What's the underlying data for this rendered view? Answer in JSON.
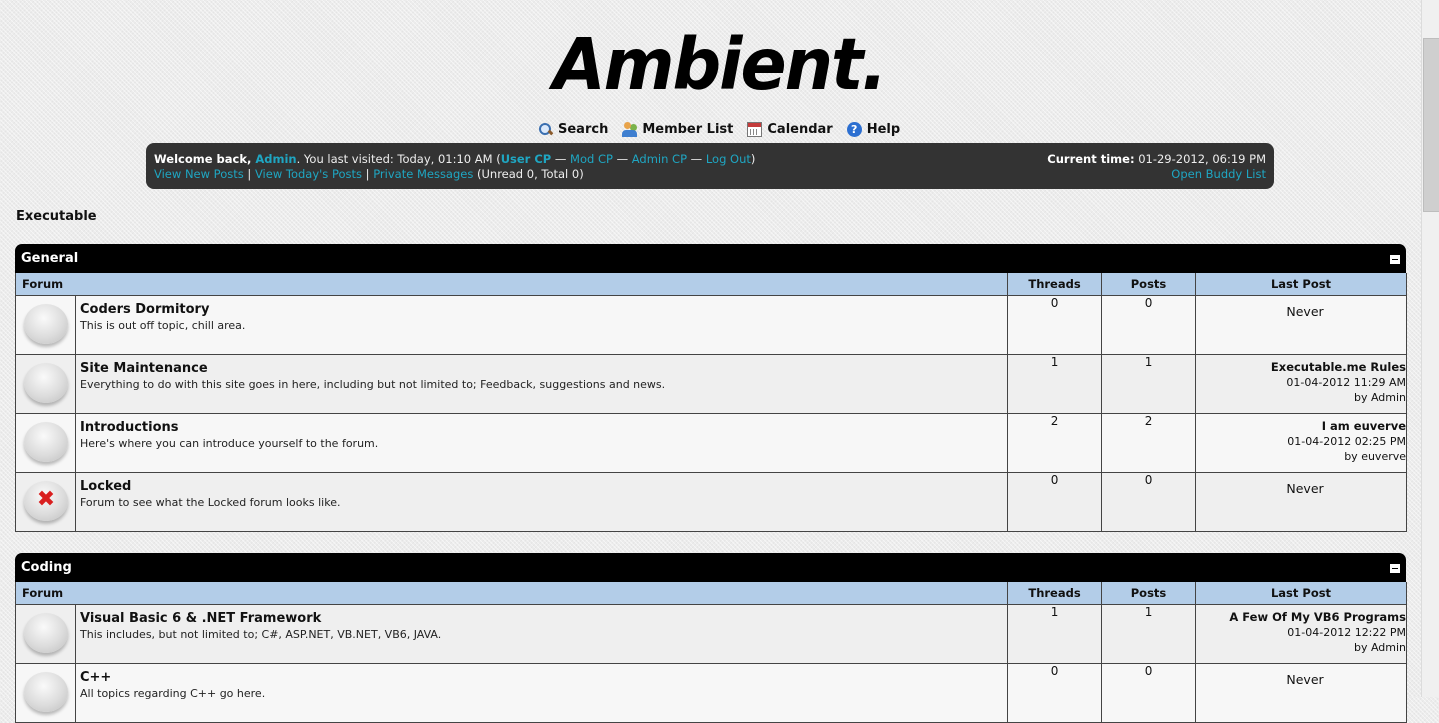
{
  "logo_text": "Ambient.",
  "nav": [
    {
      "label": "Search",
      "icon": "search-icon"
    },
    {
      "label": "Member List",
      "icon": "members-icon"
    },
    {
      "label": "Calendar",
      "icon": "calendar-icon"
    },
    {
      "label": "Help",
      "icon": "help-icon"
    }
  ],
  "welcome": {
    "prefix": "Welcome back, ",
    "user": "Admin",
    "visited": ". You last visited: Today, 01:10 AM (",
    "user_cp": "User CP",
    "sep": " — ",
    "mod_cp": "Mod CP",
    "admin_cp": "Admin CP",
    "logout": "Log Out",
    "close": ")",
    "view_new": "View New Posts",
    "pipe": " | ",
    "view_today": "View Today's Posts",
    "pm": "Private Messages",
    "pm_counts": " (Unread 0, Total 0)",
    "current_label": "Current time:",
    "current_value": " 01-29-2012, 06:19 PM",
    "buddy": "Open Buddy List"
  },
  "board_title": "Executable",
  "columns": {
    "forum": "Forum",
    "threads": "Threads",
    "posts": "Posts",
    "last": "Last Post"
  },
  "categories": [
    {
      "name": "General",
      "forums": [
        {
          "name": "Coders Dormitory",
          "desc": "This is out off topic, chill area.",
          "threads": "0",
          "posts": "0",
          "last": "Never"
        },
        {
          "name": "Site Maintenance",
          "desc": "Everything to do with this site goes in here, including but not limited to; Feedback, suggestions and news.",
          "threads": "1",
          "posts": "1",
          "last_title": "Executable.me Rules",
          "last_date": "01-04-2012 11:29 AM",
          "last_by": "by Admin"
        },
        {
          "name": "Introductions",
          "desc": "Here's where you can introduce yourself to the forum.",
          "threads": "2",
          "posts": "2",
          "last_title": "I am euverve",
          "last_date": "01-04-2012 02:25 PM",
          "last_by": "by euverve"
        },
        {
          "name": "Locked",
          "desc": "Forum to see what the Locked forum looks like.",
          "threads": "0",
          "posts": "0",
          "last": "Never",
          "locked": true
        }
      ]
    },
    {
      "name": "Coding",
      "forums": [
        {
          "name": "Visual Basic 6 & .NET Framework",
          "desc": "This includes, but not limited to; C#, ASP.NET, VB.NET, VB6, JAVA.",
          "threads": "1",
          "posts": "1",
          "last_title": "A Few Of My VB6 Programs",
          "last_date": "01-04-2012 12:22 PM",
          "last_by": "by Admin"
        },
        {
          "name": "C++",
          "desc": "All topics regarding C++ go here.",
          "threads": "0",
          "posts": "0",
          "last": "Never"
        }
      ]
    }
  ]
}
